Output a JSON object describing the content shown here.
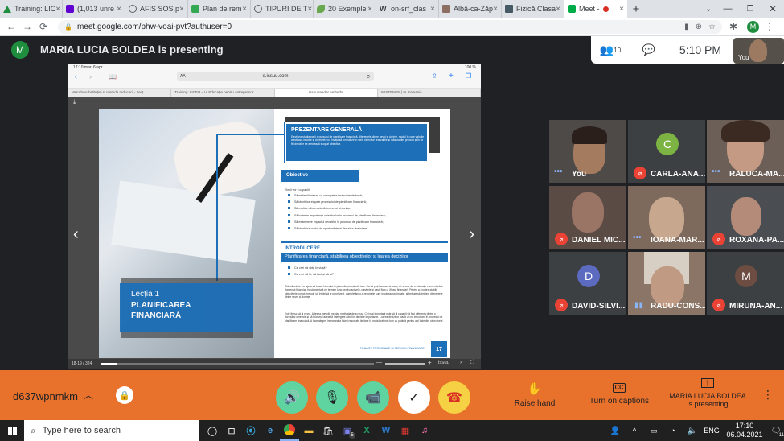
{
  "browser": {
    "tabs": [
      {
        "label": "Training: LIC"
      },
      {
        "label": "(1,013 unre"
      },
      {
        "label": "AFIS SOS.p"
      },
      {
        "label": "Plan de rem"
      },
      {
        "label": "TIPURI DE T"
      },
      {
        "label": "20 Exemple"
      },
      {
        "label": "on-srf_clas"
      },
      {
        "label": "Albă-ca-Zăp"
      },
      {
        "label": "Fizică Clasa"
      },
      {
        "label": "Meet -"
      }
    ],
    "url": "meet.google.com/phw-voai-pvt?authuser=0",
    "profile_initial": "M"
  },
  "meet": {
    "presenter_initial": "M",
    "presenter_text": "MARIA LUCIA BOLDEA is presenting",
    "participants_count": "10",
    "time": "5:10 PM",
    "self_label": "You",
    "meeting_code": "d637wpnmkm",
    "raise_hand": "Raise hand",
    "captions": "Turn on captions",
    "presenting_name": "MARIA LUCIA BOLDEA",
    "presenting_sub": "is presenting",
    "tiles": [
      {
        "name": "You",
        "muted": false
      },
      {
        "name": "CARLA-ANA...",
        "initial": "C",
        "muted": true
      },
      {
        "name": "RALUCA-MA...",
        "muted": false
      },
      {
        "name": "DANIEL MIC...",
        "muted": true
      },
      {
        "name": "IOANA-MAR...",
        "muted": false
      },
      {
        "name": "ROXANA-PA...",
        "muted": true
      },
      {
        "name": "DAVID-SILVI...",
        "initial": "D",
        "muted": true
      },
      {
        "name": "RADU-CONS...",
        "muted": false
      },
      {
        "name": "MIRUNA-AN...",
        "initial": "M",
        "muted": true
      }
    ]
  },
  "shared": {
    "ipad_status_time": "17:10  mar. 6 apr.",
    "ipad_battery": "100 %",
    "ipad_address": "e.issuu.com",
    "ipad_tabs": [
      "Metoda substituției si metoda reducerii - Lecț...",
      "Training: LICEU – IA Educație pentru antreprenor...",
      "Issuu reader embeds",
      "WISTEMPS | IA Romania"
    ],
    "section_title": "PREZENTARE GENERALĂ",
    "section_text": "Elevii vor studia pașii procesului de planificare financiară, diferențele dintre nevoi și dorințe, modul în care valorile afectează nevoile și dorințele; vor învăța să formuleze în scris obiective realizabile și măsurabile, precum și în ce fel deciziile se afectează scopuri obiective.",
    "objectives_title": "Obiective",
    "objectives_intro": "Elevii vor fi capabili:",
    "objectives": [
      "Să se familiarizeze cu conceptele financiare de bază;",
      "Să identifice etapele procesului de planificare financiară;",
      "Să explice diferențele dintre nevoi și dorințe;",
      "Să lustreze importanța obiectivelor în procesul de planificare financiară;",
      "Să examineze impactul deciziilor în procesul de planificare financiară;",
      "Să identifice costul de oportunitate al deciziilor financiare."
    ],
    "intro_title": "INTRODUCERE",
    "intro_sub": "Planificarea financiară, stabilirea obiectivelor și luarea deciziilor",
    "questions": [
      "Ce vrei să obții în viață?",
      "Ce vrei să fii, să faci și să ai?"
    ],
    "body_text_1": "Obiectivele te vor ajuta să trasezi direcția în planurile și acțiunile tale. Ca să poți face acest lucru, ai nevoie de o educație elementară în domeniul financiar, fundamentală pe termen lung pentru activele, pasivele și cash flow-ul (fluxul financiar). Pentru a-ți putea stabili obiectivele corect, trebuie să învăți să le prioritizezi, completându-ți resursele sunt întotdeauna limitate, și trebuie să înțelegi diferențele dintre nevoi și dorințe.",
    "body_text_2": "Este firesc să ai nevoi. Adesea, nevoile ne dau motivația de a reuși. Cel mai important este să fii capabil să faci diferența dintre o dorință și o nevoie și să folosești această înțelegere când iei decizile importante. Luarea deciziilor joacă un rol important în procesul de planificare financiară. A face alegeri înseamnă a folosi resursele limitate în modul cel mai bun cu putință pentru a-ți îndeplini obiectivele.",
    "lesson_label": "Lecția 1",
    "lesson_title_1": "PLANIFICAREA",
    "lesson_title_2": "FINANCIARĂ",
    "footer_text": "FINANȚE PERSONALE ȘI SERVICII FINANCIARE",
    "page_number": "17",
    "page_indicator": "18-19 / 324",
    "issuu_brand": "issuu",
    "viewer_progress": 0.06
  },
  "taskbar": {
    "search_placeholder": "Type here to search",
    "time": "17:10",
    "date": "06.04.2021",
    "lang": "ENG",
    "notif_count": "11"
  }
}
